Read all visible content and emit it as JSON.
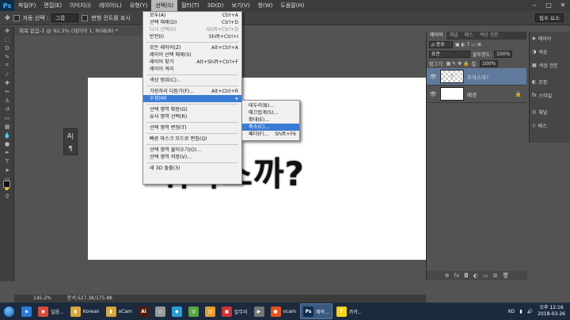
{
  "menubar": {
    "logo": "Ps",
    "items": [
      "파일(F)",
      "편집(E)",
      "이미지(I)",
      "레이어(L)",
      "유형(Y)",
      "선택(S)",
      "필터(T)",
      "3D(D)",
      "보기(V)",
      "창(W)",
      "도움말(H)"
    ],
    "active_index": 5,
    "win_min": "‒",
    "win_max": "□",
    "win_close": "✕"
  },
  "options": {
    "auto_select_label": "자동 선택 :",
    "auto_select_value": "그룹",
    "transform_label": "변형 컨트롤 표시",
    "workspace": "필수 요소"
  },
  "doc_tab": "제목 없음-1 @ 92.3% (레이어 1, RGB/8) *",
  "select_menu": [
    {
      "label": "모두(A)",
      "shortcut": "Ctrl+A",
      "state": "normal"
    },
    {
      "label": "선택 해제(D)",
      "shortcut": "Ctrl+D",
      "state": "normal"
    },
    {
      "label": "다시 선택(E)",
      "shortcut": "Shift+Ctrl+D",
      "state": "disabled"
    },
    {
      "label": "반전(I)",
      "shortcut": "Shift+Ctrl+I",
      "state": "normal"
    },
    {
      "sep": true
    },
    {
      "label": "모든 레이어(Z)",
      "shortcut": "Alt+Ctrl+A",
      "state": "normal"
    },
    {
      "label": "레이어 선택 해제(S)",
      "shortcut": "",
      "state": "normal"
    },
    {
      "label": "레이어 찾기",
      "shortcut": "Alt+Shift+Ctrl+F",
      "state": "normal"
    },
    {
      "label": "레이어 격리",
      "shortcut": "",
      "state": "normal"
    },
    {
      "sep": true
    },
    {
      "label": "색상 범위(C)...",
      "shortcut": "",
      "state": "normal"
    },
    {
      "sep": true
    },
    {
      "label": "가장자리 다듬기(F)...",
      "shortcut": "Alt+Ctrl+R",
      "state": "normal"
    },
    {
      "label": "수정(M)",
      "shortcut": "▸",
      "state": "highlight"
    },
    {
      "sep": true
    },
    {
      "label": "선택 영역 확장(G)",
      "shortcut": "",
      "state": "normal"
    },
    {
      "label": "유사 영역 선택(R)",
      "shortcut": "",
      "state": "normal"
    },
    {
      "sep": true
    },
    {
      "label": "선택 영역 변형(T)",
      "shortcut": "",
      "state": "normal"
    },
    {
      "sep": true
    },
    {
      "label": "빠른 마스크 모드로 편집(Q)",
      "shortcut": "",
      "state": "normal"
    },
    {
      "sep": true
    },
    {
      "label": "선택 영역 불러오기(O)...",
      "shortcut": "",
      "state": "normal"
    },
    {
      "label": "선택 영역 저장(V)...",
      "shortcut": "",
      "state": "normal"
    },
    {
      "sep": true
    },
    {
      "label": "새 3D 돌출(3)",
      "shortcut": "",
      "state": "normal"
    }
  ],
  "modify_submenu": [
    {
      "label": "테두리(B)...",
      "shortcut": "",
      "state": "normal"
    },
    {
      "label": "매끄럽게(S)...",
      "shortcut": "",
      "state": "normal"
    },
    {
      "label": "확대(E)...",
      "shortcut": "",
      "state": "normal"
    },
    {
      "label": "축소(C)...",
      "shortcut": "",
      "state": "highlight"
    },
    {
      "label": "페더(F)...",
      "shortcut": "Shift+F6",
      "state": "normal"
    }
  ],
  "canvas": {
    "text": "뭐라스까?"
  },
  "status": {
    "zoom": "145.2%",
    "doc": "문서:527.3K/175.8K"
  },
  "layers_panel": {
    "tabs": [
      "레이어",
      "채널",
      "패스",
      "색상 견본"
    ],
    "kind_label": "ρ 종류",
    "blend_mode": "표준",
    "opacity_label": "불투명도:",
    "opacity": "100%",
    "lock_label": "잠그기:",
    "fill_label": "칠:",
    "fill": "100%",
    "layers": [
      {
        "name": "무자스까?",
        "thumb": "T",
        "selected": true
      },
      {
        "name": "배경",
        "thumb": "",
        "selected": false
      }
    ],
    "footer_icons": [
      "⊕",
      "fx",
      "◘",
      "◐",
      "▭",
      "⊞",
      "🗑"
    ]
  },
  "side_panel": {
    "items": [
      "레이어",
      "색상",
      "색상 견본",
      "조정",
      "스타일",
      "채널",
      "패스"
    ]
  },
  "taskbar": {
    "items": [
      {
        "label": "",
        "icon": "e",
        "color": "#2c7ad6"
      },
      {
        "label": "얼음...",
        "icon": "◉",
        "color": "#d94a38"
      },
      {
        "label": "Korean",
        "icon": "▮",
        "color": "#d8a73a"
      },
      {
        "label": "oCam",
        "icon": "▮",
        "color": "#d8a73a"
      },
      {
        "label": "",
        "icon": "Ai",
        "color": "#4a1d08"
      },
      {
        "label": "",
        "icon": "◇",
        "color": "#9a9a9a"
      },
      {
        "label": "",
        "icon": "◆",
        "color": "#2c9dd6"
      },
      {
        "label": "",
        "icon": "◎",
        "color": "#56a641"
      },
      {
        "label": "",
        "icon": "◫",
        "color": "#e0a030"
      },
      {
        "label": "칼무리",
        "icon": "▣",
        "color": "#c33"
      },
      {
        "label": "",
        "icon": "▶",
        "color": "#777"
      },
      {
        "label": "ocam",
        "icon": "●",
        "color": "#e4541b"
      },
      {
        "label": "제목...",
        "icon": "Ps",
        "color": "#0c2f4a"
      },
      {
        "label": "카카...",
        "icon": "T",
        "color": "#f7d41e"
      }
    ],
    "tray_lang": "KO",
    "time": "오후 12:16",
    "date": "2018-03-26"
  }
}
